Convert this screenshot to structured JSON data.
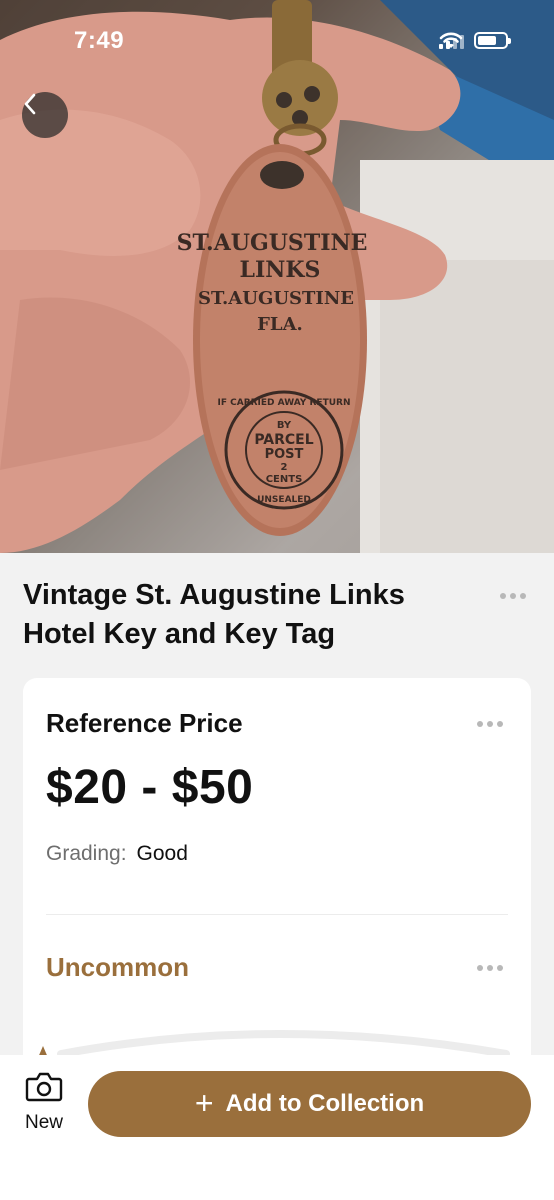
{
  "status_bar": {
    "time": "7:49"
  },
  "item": {
    "title": "Vintage St. Augustine Links Hotel Key and Key Tag"
  },
  "reference": {
    "label": "Reference Price",
    "price": "$20 - $50",
    "grading_label": "Grading:",
    "grading_value": "Good"
  },
  "rarity": {
    "label": "Uncommon"
  },
  "bottom_bar": {
    "new_label": "New",
    "add_label": "Add to Collection"
  },
  "photo": {
    "tag_lines": [
      "ST.AUGUSTINE",
      "LINKS",
      "ST.AUGUSTINE",
      "FLA."
    ],
    "stamp_lines": [
      "BY",
      "PARCEL",
      "POST",
      "2",
      "CENTS"
    ],
    "stamp_ring_top": "IF CARRIED AWAY RETURN",
    "stamp_ring_bottom": "UNSEALED"
  },
  "colors": {
    "accent": "#9a6f3c",
    "copper": "#b5735a"
  }
}
